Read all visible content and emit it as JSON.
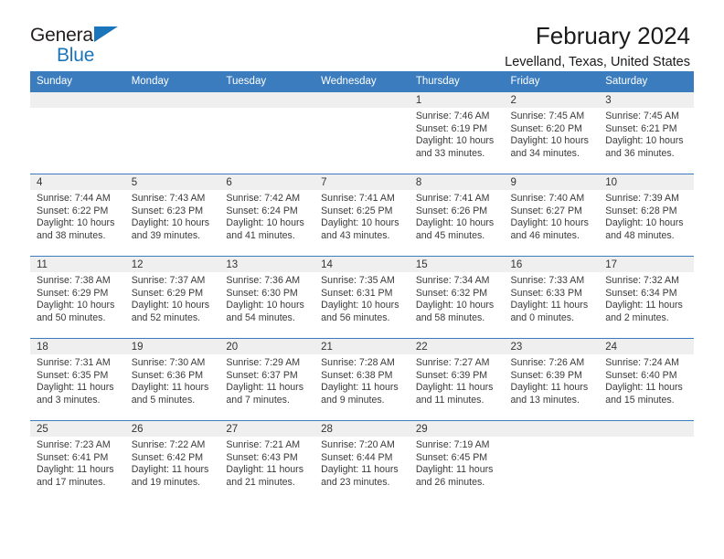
{
  "brand": {
    "name_part1": "General",
    "name_part2": "Blue",
    "accent_color": "#1b75bb",
    "triangle_icon": "brand-triangle-icon"
  },
  "header": {
    "title": "February 2024",
    "location": "Levelland, Texas, United States"
  },
  "calendar": {
    "header_bg": "#3a7cbe",
    "daynum_bg": "#efefef",
    "weekday_headers": [
      "Sunday",
      "Monday",
      "Tuesday",
      "Wednesday",
      "Thursday",
      "Friday",
      "Saturday"
    ],
    "weeks": [
      [
        {
          "day": "",
          "sunrise": "",
          "sunset": "",
          "daylight_line1": "",
          "daylight_line2": ""
        },
        {
          "day": "",
          "sunrise": "",
          "sunset": "",
          "daylight_line1": "",
          "daylight_line2": ""
        },
        {
          "day": "",
          "sunrise": "",
          "sunset": "",
          "daylight_line1": "",
          "daylight_line2": ""
        },
        {
          "day": "",
          "sunrise": "",
          "sunset": "",
          "daylight_line1": "",
          "daylight_line2": ""
        },
        {
          "day": "1",
          "sunrise": "Sunrise: 7:46 AM",
          "sunset": "Sunset: 6:19 PM",
          "daylight_line1": "Daylight: 10 hours",
          "daylight_line2": "and 33 minutes."
        },
        {
          "day": "2",
          "sunrise": "Sunrise: 7:45 AM",
          "sunset": "Sunset: 6:20 PM",
          "daylight_line1": "Daylight: 10 hours",
          "daylight_line2": "and 34 minutes."
        },
        {
          "day": "3",
          "sunrise": "Sunrise: 7:45 AM",
          "sunset": "Sunset: 6:21 PM",
          "daylight_line1": "Daylight: 10 hours",
          "daylight_line2": "and 36 minutes."
        }
      ],
      [
        {
          "day": "4",
          "sunrise": "Sunrise: 7:44 AM",
          "sunset": "Sunset: 6:22 PM",
          "daylight_line1": "Daylight: 10 hours",
          "daylight_line2": "and 38 minutes."
        },
        {
          "day": "5",
          "sunrise": "Sunrise: 7:43 AM",
          "sunset": "Sunset: 6:23 PM",
          "daylight_line1": "Daylight: 10 hours",
          "daylight_line2": "and 39 minutes."
        },
        {
          "day": "6",
          "sunrise": "Sunrise: 7:42 AM",
          "sunset": "Sunset: 6:24 PM",
          "daylight_line1": "Daylight: 10 hours",
          "daylight_line2": "and 41 minutes."
        },
        {
          "day": "7",
          "sunrise": "Sunrise: 7:41 AM",
          "sunset": "Sunset: 6:25 PM",
          "daylight_line1": "Daylight: 10 hours",
          "daylight_line2": "and 43 minutes."
        },
        {
          "day": "8",
          "sunrise": "Sunrise: 7:41 AM",
          "sunset": "Sunset: 6:26 PM",
          "daylight_line1": "Daylight: 10 hours",
          "daylight_line2": "and 45 minutes."
        },
        {
          "day": "9",
          "sunrise": "Sunrise: 7:40 AM",
          "sunset": "Sunset: 6:27 PM",
          "daylight_line1": "Daylight: 10 hours",
          "daylight_line2": "and 46 minutes."
        },
        {
          "day": "10",
          "sunrise": "Sunrise: 7:39 AM",
          "sunset": "Sunset: 6:28 PM",
          "daylight_line1": "Daylight: 10 hours",
          "daylight_line2": "and 48 minutes."
        }
      ],
      [
        {
          "day": "11",
          "sunrise": "Sunrise: 7:38 AM",
          "sunset": "Sunset: 6:29 PM",
          "daylight_line1": "Daylight: 10 hours",
          "daylight_line2": "and 50 minutes."
        },
        {
          "day": "12",
          "sunrise": "Sunrise: 7:37 AM",
          "sunset": "Sunset: 6:29 PM",
          "daylight_line1": "Daylight: 10 hours",
          "daylight_line2": "and 52 minutes."
        },
        {
          "day": "13",
          "sunrise": "Sunrise: 7:36 AM",
          "sunset": "Sunset: 6:30 PM",
          "daylight_line1": "Daylight: 10 hours",
          "daylight_line2": "and 54 minutes."
        },
        {
          "day": "14",
          "sunrise": "Sunrise: 7:35 AM",
          "sunset": "Sunset: 6:31 PM",
          "daylight_line1": "Daylight: 10 hours",
          "daylight_line2": "and 56 minutes."
        },
        {
          "day": "15",
          "sunrise": "Sunrise: 7:34 AM",
          "sunset": "Sunset: 6:32 PM",
          "daylight_line1": "Daylight: 10 hours",
          "daylight_line2": "and 58 minutes."
        },
        {
          "day": "16",
          "sunrise": "Sunrise: 7:33 AM",
          "sunset": "Sunset: 6:33 PM",
          "daylight_line1": "Daylight: 11 hours",
          "daylight_line2": "and 0 minutes."
        },
        {
          "day": "17",
          "sunrise": "Sunrise: 7:32 AM",
          "sunset": "Sunset: 6:34 PM",
          "daylight_line1": "Daylight: 11 hours",
          "daylight_line2": "and 2 minutes."
        }
      ],
      [
        {
          "day": "18",
          "sunrise": "Sunrise: 7:31 AM",
          "sunset": "Sunset: 6:35 PM",
          "daylight_line1": "Daylight: 11 hours",
          "daylight_line2": "and 3 minutes."
        },
        {
          "day": "19",
          "sunrise": "Sunrise: 7:30 AM",
          "sunset": "Sunset: 6:36 PM",
          "daylight_line1": "Daylight: 11 hours",
          "daylight_line2": "and 5 minutes."
        },
        {
          "day": "20",
          "sunrise": "Sunrise: 7:29 AM",
          "sunset": "Sunset: 6:37 PM",
          "daylight_line1": "Daylight: 11 hours",
          "daylight_line2": "and 7 minutes."
        },
        {
          "day": "21",
          "sunrise": "Sunrise: 7:28 AM",
          "sunset": "Sunset: 6:38 PM",
          "daylight_line1": "Daylight: 11 hours",
          "daylight_line2": "and 9 minutes."
        },
        {
          "day": "22",
          "sunrise": "Sunrise: 7:27 AM",
          "sunset": "Sunset: 6:39 PM",
          "daylight_line1": "Daylight: 11 hours",
          "daylight_line2": "and 11 minutes."
        },
        {
          "day": "23",
          "sunrise": "Sunrise: 7:26 AM",
          "sunset": "Sunset: 6:39 PM",
          "daylight_line1": "Daylight: 11 hours",
          "daylight_line2": "and 13 minutes."
        },
        {
          "day": "24",
          "sunrise": "Sunrise: 7:24 AM",
          "sunset": "Sunset: 6:40 PM",
          "daylight_line1": "Daylight: 11 hours",
          "daylight_line2": "and 15 minutes."
        }
      ],
      [
        {
          "day": "25",
          "sunrise": "Sunrise: 7:23 AM",
          "sunset": "Sunset: 6:41 PM",
          "daylight_line1": "Daylight: 11 hours",
          "daylight_line2": "and 17 minutes."
        },
        {
          "day": "26",
          "sunrise": "Sunrise: 7:22 AM",
          "sunset": "Sunset: 6:42 PM",
          "daylight_line1": "Daylight: 11 hours",
          "daylight_line2": "and 19 minutes."
        },
        {
          "day": "27",
          "sunrise": "Sunrise: 7:21 AM",
          "sunset": "Sunset: 6:43 PM",
          "daylight_line1": "Daylight: 11 hours",
          "daylight_line2": "and 21 minutes."
        },
        {
          "day": "28",
          "sunrise": "Sunrise: 7:20 AM",
          "sunset": "Sunset: 6:44 PM",
          "daylight_line1": "Daylight: 11 hours",
          "daylight_line2": "and 23 minutes."
        },
        {
          "day": "29",
          "sunrise": "Sunrise: 7:19 AM",
          "sunset": "Sunset: 6:45 PM",
          "daylight_line1": "Daylight: 11 hours",
          "daylight_line2": "and 26 minutes."
        },
        {
          "day": "",
          "sunrise": "",
          "sunset": "",
          "daylight_line1": "",
          "daylight_line2": ""
        },
        {
          "day": "",
          "sunrise": "",
          "sunset": "",
          "daylight_line1": "",
          "daylight_line2": ""
        }
      ]
    ]
  }
}
